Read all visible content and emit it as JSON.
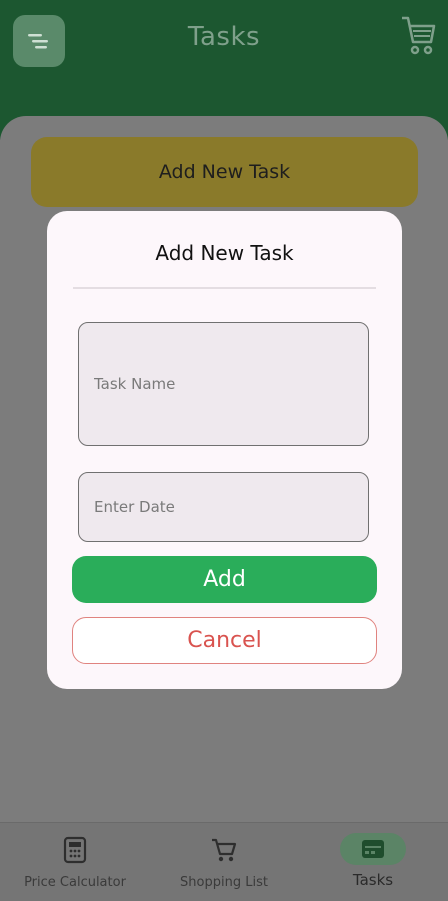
{
  "header": {
    "title": "Tasks",
    "menu_icon": "menu-icon",
    "cart_icon": "cart-icon"
  },
  "banner": {
    "label": "Add New Task"
  },
  "dialog": {
    "title": "Add New Task",
    "task_name_placeholder": "Task Name",
    "task_name_value": "",
    "date_placeholder": "Enter Date",
    "date_value": "",
    "add_label": "Add",
    "cancel_label": "Cancel"
  },
  "bottom_nav": {
    "items": [
      {
        "label": "Price Calculator",
        "icon": "calculator-icon",
        "active": false
      },
      {
        "label": "Shopping List",
        "icon": "cart-icon",
        "active": false
      },
      {
        "label": "Tasks",
        "icon": "tasks-icon",
        "active": true
      }
    ]
  },
  "colors": {
    "header_green": "#1c5730",
    "add_button": "#2aad5a",
    "cancel_text": "#d9534f",
    "banner_yellow": "#8a7a2a",
    "dialog_bg": "#fdf7fb"
  }
}
